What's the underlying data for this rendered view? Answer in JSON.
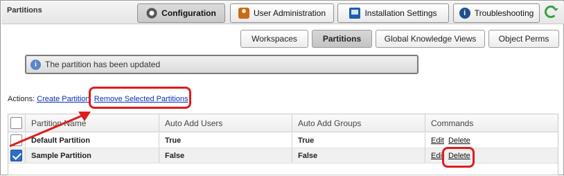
{
  "app": {
    "title": "Partitions"
  },
  "topnav": {
    "items": [
      {
        "label": "Configuration",
        "icon": "gear-icon",
        "active": true
      },
      {
        "label": "User Administration",
        "icon": "user-icon",
        "active": false
      },
      {
        "label": "Installation Settings",
        "icon": "installation-icon",
        "active": false
      },
      {
        "label": "Troubleshooting",
        "icon": "info-icon",
        "active": false
      }
    ],
    "refresh_icon": "refresh-icon"
  },
  "subtabs": [
    {
      "label": "Workspaces",
      "active": false
    },
    {
      "label": "Partitions",
      "active": true
    },
    {
      "label": "Global Knowledge Views",
      "active": false
    },
    {
      "label": "Object Perms",
      "active": false
    }
  ],
  "notice": {
    "text": "The partition has been updated",
    "icon": "info-icon"
  },
  "actions": {
    "label": "Actions:",
    "create": "Create Partition",
    "remove": "Remove Selected Partitions"
  },
  "table": {
    "headers": [
      "Partition Name",
      "Auto Add Users",
      "Auto Add Groups",
      "Commands"
    ],
    "rows": [
      {
        "name": "Default Partition",
        "users": "True",
        "groups": "True",
        "edit": "Edit",
        "delete": "Delete",
        "checked": false
      },
      {
        "name": "Sample Partition",
        "users": "False",
        "groups": "False",
        "edit": "Edit",
        "delete": "Delete",
        "checked": true
      }
    ]
  },
  "colors": {
    "accent_red": "#e01b1b",
    "checkbox_blue": "#2f6fc8",
    "link_blue": "#0a2fb6"
  }
}
